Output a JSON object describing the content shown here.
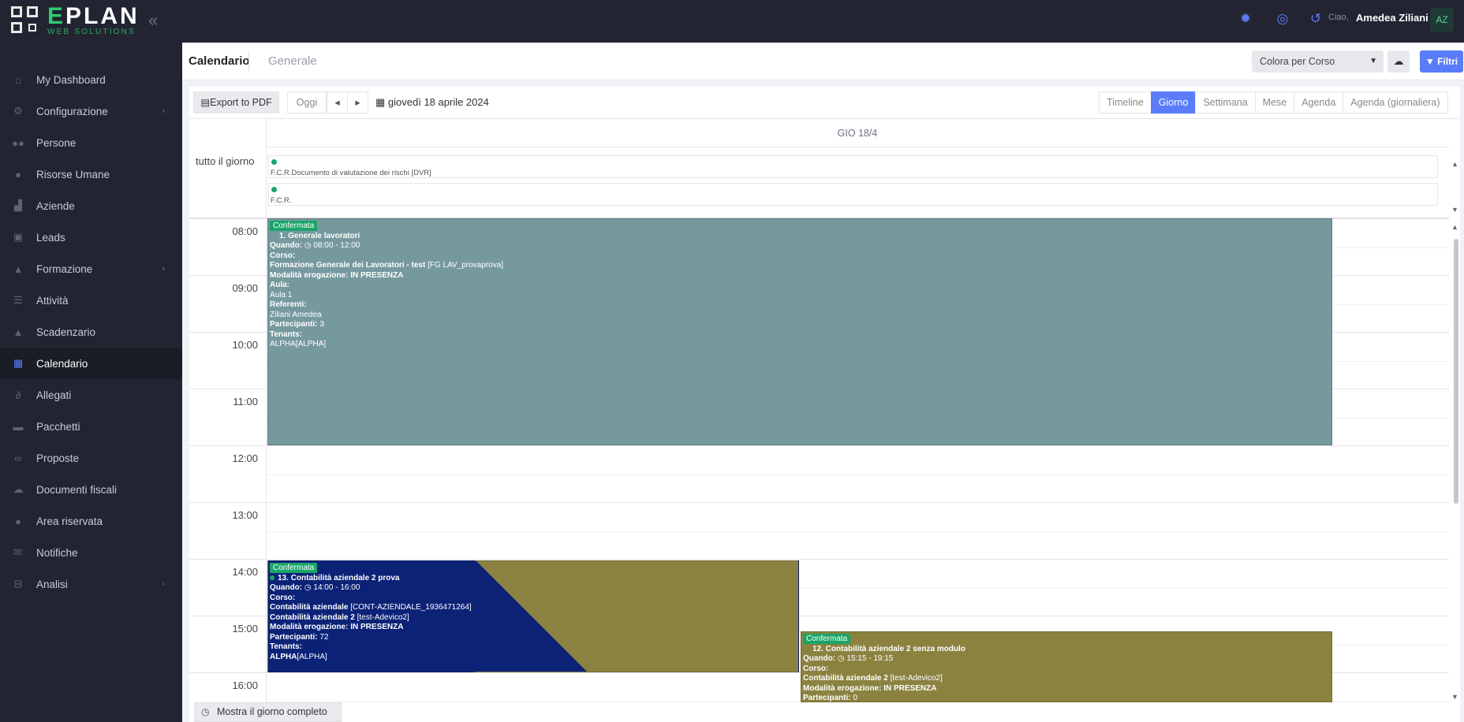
{
  "app": {
    "logo_main": "EPLAN",
    "logo_sub": "WEB SOLUTIONS",
    "accent": "#5b7cfa"
  },
  "sidebar": {
    "items": [
      {
        "label": "My Dashboard",
        "icon": "home-icon"
      },
      {
        "label": "Configurazione",
        "icon": "gear-icon",
        "chevron": true
      },
      {
        "label": "Persone",
        "icon": "users-icon"
      },
      {
        "label": "Risorse Umane",
        "icon": "user-tie-icon"
      },
      {
        "label": "Aziende",
        "icon": "chart-icon"
      },
      {
        "label": "Leads",
        "icon": "address-book-icon"
      },
      {
        "label": "Formazione",
        "icon": "graduation-cap-icon",
        "chevron": true
      },
      {
        "label": "Attività",
        "icon": "tasks-icon"
      },
      {
        "label": "Scadenzario",
        "icon": "warning-icon"
      },
      {
        "label": "Calendario",
        "icon": "calendar-icon",
        "active": true
      },
      {
        "label": "Allegati",
        "icon": "paperclip-icon"
      },
      {
        "label": "Pacchetti",
        "icon": "package-icon"
      },
      {
        "label": "Proposte",
        "icon": "handshake-icon"
      },
      {
        "label": "Documenti fiscali",
        "icon": "cloud-icon"
      },
      {
        "label": "Area riservata",
        "icon": "user-lock-icon"
      },
      {
        "label": "Notifiche",
        "icon": "envelope-icon"
      },
      {
        "label": "Analisi",
        "icon": "analytics-icon",
        "chevron": true
      }
    ]
  },
  "topbar": {
    "greeting": "Ciao,",
    "user_name": "Amedea Ziliani",
    "avatar_initials": "AZ"
  },
  "page": {
    "title": "Calendario",
    "subtitle": "Generale",
    "color_select": "Colora per Corso",
    "filter_label": "Filtri"
  },
  "toolbar": {
    "export_label": "Export to PDF",
    "today_label": "Oggi",
    "date_label": "giovedì 18 aprile 2024",
    "views": [
      "Timeline",
      "Giorno",
      "Settimana",
      "Mese",
      "Agenda",
      "Agenda (giornaliera)"
    ],
    "active_view": "Giorno"
  },
  "calendar": {
    "day_header": "GIO 18/4",
    "allday_label": "tutto il giorno",
    "allday_events": [
      "F.C.R.Documento di valutazione dei rischi [DVR]",
      "F.C.R."
    ],
    "hours": [
      "08:00",
      "09:00",
      "10:00",
      "11:00",
      "12:00",
      "13:00",
      "14:00",
      "15:00",
      "16:00"
    ],
    "events": [
      {
        "badge": "Confermata",
        "title": "1. Generale lavoratori",
        "when_label": "Quando:",
        "when": "08:00 - 12:00",
        "course_label": "Corso:",
        "course": "Formazione Generale dei Lavoratori - test",
        "course_code": "[FG LAV_provaprova]",
        "mode": "Modalità erogazione: IN PRESENZA",
        "room_label": "Aula:",
        "room": "Aula 1",
        "ref_label": "Referenti:",
        "ref": "Ziliani Amedea",
        "participants_label": "Partecipanti:",
        "participants": "3",
        "tenants_label": "Tenants:",
        "tenants": "ALPHA[ALPHA]",
        "color": "#76999e"
      },
      {
        "badge": "Confermata",
        "title": "13. Contabilità aziendale 2 prova",
        "when_label": "Quando:",
        "when": "14:00 - 16:00",
        "course_label": "Corso:",
        "course": "Contabilità aziendale",
        "course_code": "[CONT-AZIENDALE_1936471264]",
        "course2": "Contabilità aziendale 2",
        "course2_code": "[test-Adevico2]",
        "mode": "Modalità erogazione: IN PRESENZA",
        "participants_label": "Partecipanti:",
        "participants": "72",
        "tenants_label": "Tenants:",
        "tenants_bold": "ALPHA",
        "tenants_rest": "[ALPHA]",
        "color_a": "#0b2277",
        "color_b": "#8b8240"
      },
      {
        "badge": "Confermata",
        "title": "12. Contabilità aziendale 2 senza modulo",
        "when_label": "Quando:",
        "when": "15:15 - 19:15",
        "course_label": "Corso:",
        "course": "Contabilità aziendale 2",
        "course_code": "[test-Adevico2]",
        "mode": "Modalità erogazione: IN PRESENZA",
        "participants_label": "Partecipanti:",
        "participants": "0",
        "color": "#8b8240"
      }
    ],
    "footer_btn": "Mostra il giorno completo"
  }
}
